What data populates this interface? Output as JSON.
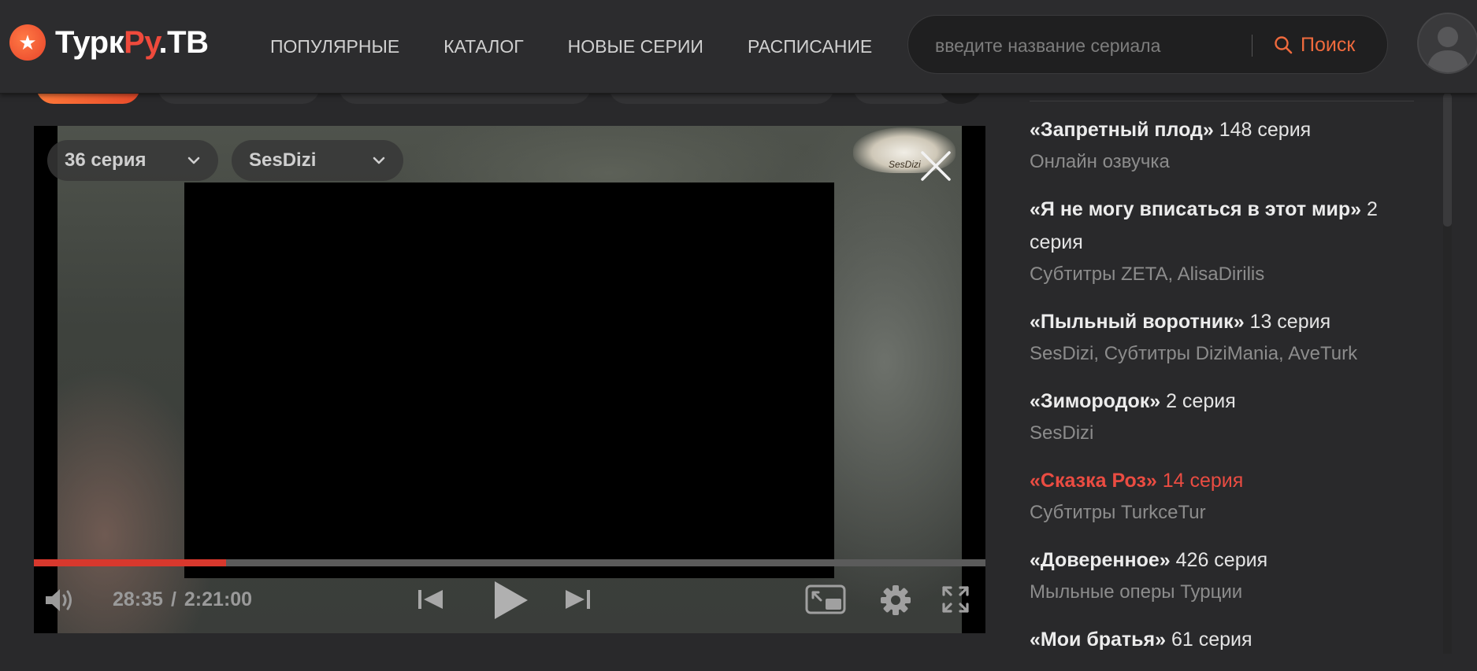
{
  "header": {
    "logo_icon": "star-icon",
    "logo_part1": "Турк",
    "logo_part2": "Ру",
    "logo_part3": ".ТВ",
    "nav": [
      {
        "label": "ПОПУЛЯРНЫЕ"
      },
      {
        "label": "КАТАЛОГ"
      },
      {
        "label": "НОВЫЕ СЕРИИ"
      },
      {
        "label": "РАСПИСАНИЕ"
      }
    ],
    "search": {
      "placeholder": "введите название сериала",
      "button_label": "Поиск"
    }
  },
  "player": {
    "episode_select": "36 серия",
    "voice_select": "SesDizi",
    "watermark": "SesDizi",
    "current_time": "28:35",
    "separator": "/",
    "duration": "2:21:00",
    "progress_fraction": 0.202
  },
  "sidebar": {
    "items": [
      {
        "title": "«Запретный плод»",
        "episode": " 148 серия",
        "sub": "Онлайн озвучка"
      },
      {
        "title": "«Я не могу вписаться в этот мир»",
        "episode": " 2 серия",
        "sub": "Субтитры ZETA, AlisaDirilis"
      },
      {
        "title": "«Пыльный воротник»",
        "episode": " 13 серия",
        "sub": "SesDizi, Субтитры DiziMania, AveTurk"
      },
      {
        "title": "«Зимородок»",
        "episode": " 2 серия",
        "sub": "SesDizi"
      },
      {
        "title": "«Сказка Роз»",
        "episode": " 14 серия",
        "sub": "Субтитры TurkceTur"
      },
      {
        "title": "«Доверенное»",
        "episode": " 426 серия",
        "sub": "Мыльные оперы Турции"
      },
      {
        "title": "«Мои братья»",
        "episode": " 61 серия",
        "sub": ""
      }
    ]
  },
  "colors": {
    "accent": "#ef6a3d",
    "highlight": "#ea4c42",
    "progress": "#d8382d",
    "background": "#29292b"
  }
}
